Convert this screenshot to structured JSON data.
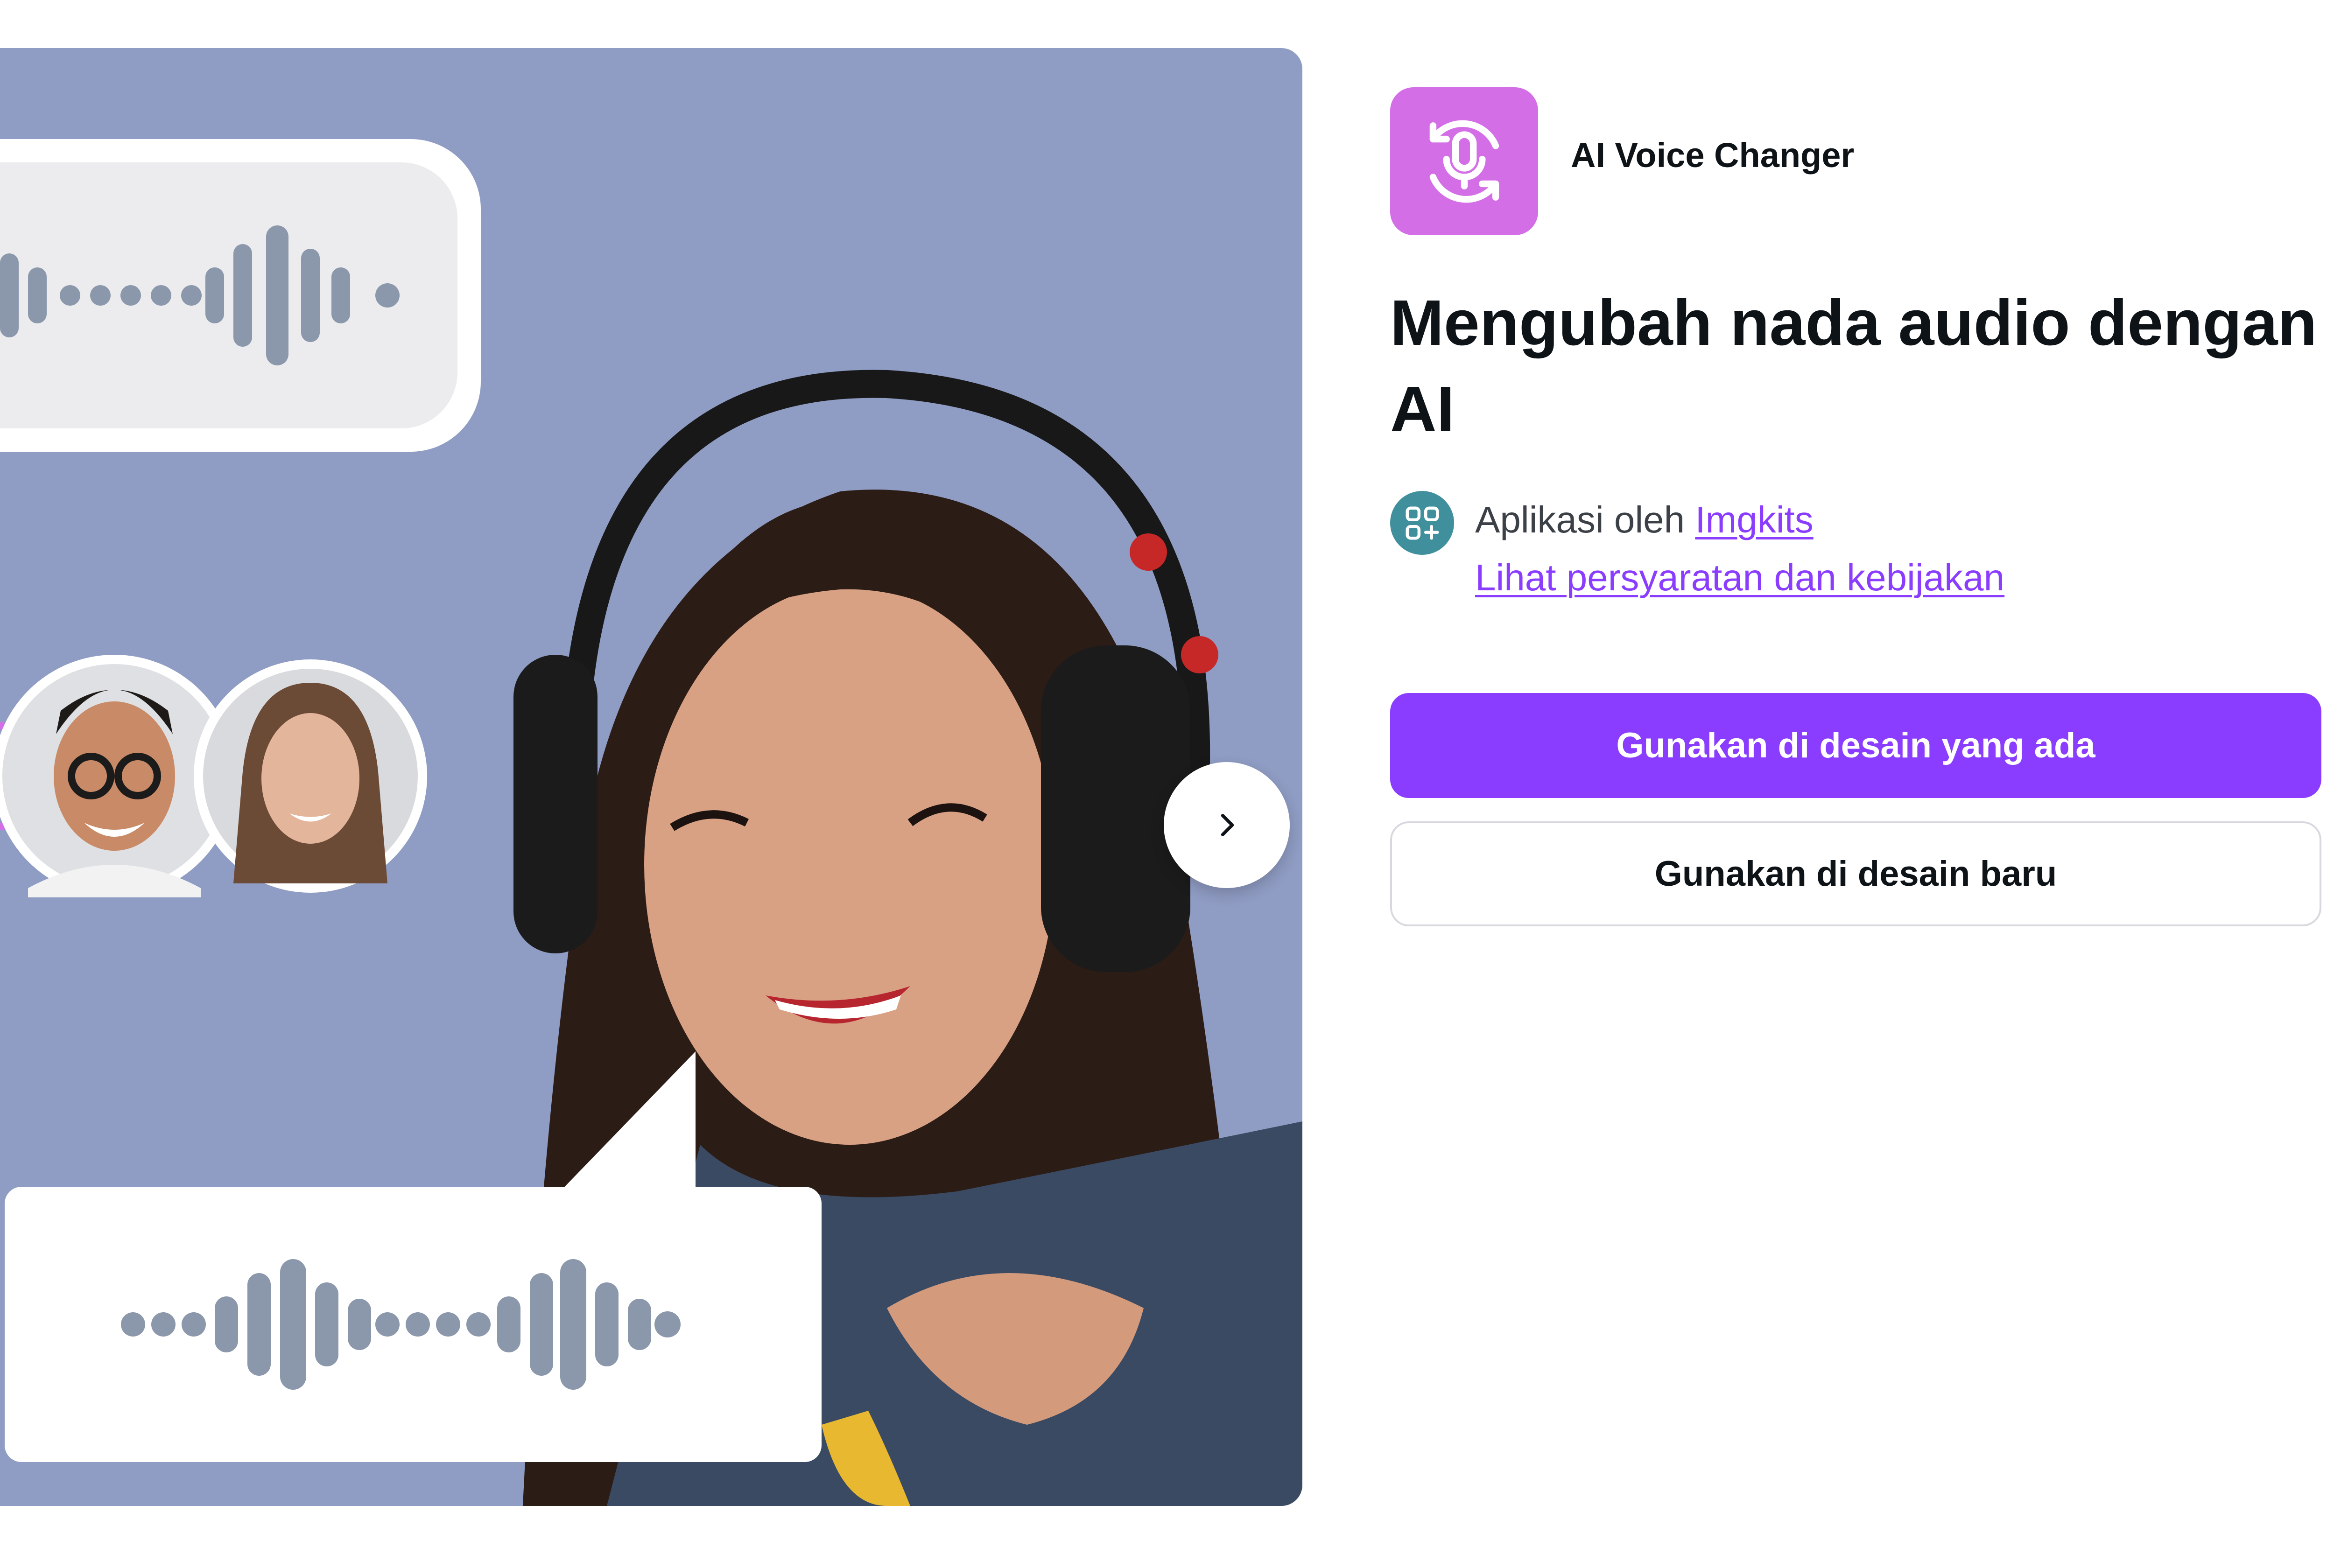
{
  "app": {
    "name": "AI Voice Changer",
    "icon": "microphone-refresh-icon",
    "accent_color": "#d36ee7"
  },
  "headline": "Mengubah nada audio dengan AI",
  "developer": {
    "prefix": "Aplikasi oleh",
    "name": "Imgkits",
    "badge_icon": "apps-grid-icon",
    "badge_color": "#3f8f9c"
  },
  "terms_link": "Lihat persyaratan dan kebijakan",
  "actions": {
    "primary": "Gunakan di desain yang ada",
    "secondary": "Gunakan di desain baru",
    "primary_color": "#8b3dff"
  },
  "carousel": {
    "next_icon": "chevron-right-icon",
    "background_color": "#8f9cc3"
  }
}
